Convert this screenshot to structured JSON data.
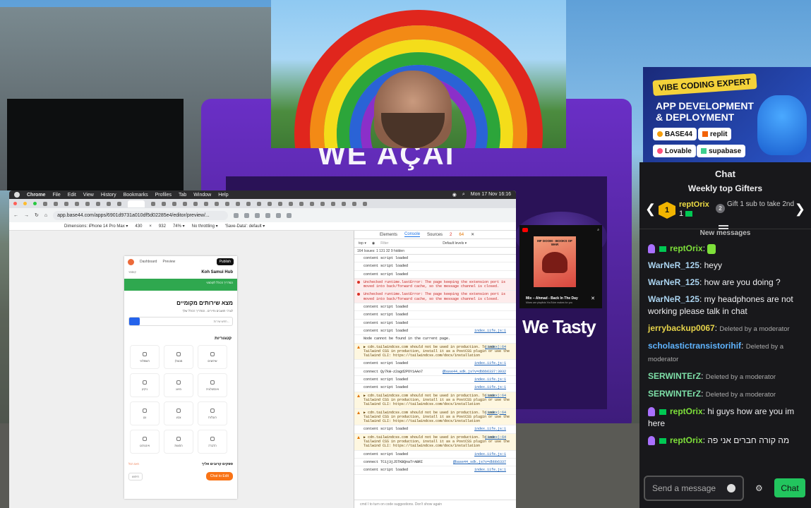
{
  "background": {
    "kiosk_sign": "WE AÇAÍ",
    "kiosk_side_text": "We Tasty"
  },
  "promo": {
    "badge": "VIBE CODING EXPERT",
    "line1": "APP DEVELOPMENT",
    "line2": "& DEPLOYMENT",
    "tools": [
      "BASE44",
      "replit",
      "Lovable",
      "supabase"
    ]
  },
  "chat": {
    "title": "Chat",
    "weekly_title": "Weekly top Gifters",
    "top_gifter": {
      "rank": "1",
      "name": "reptOrix",
      "count": "1"
    },
    "second": {
      "rank": "2",
      "text": "Gift 1 sub to take 2nd"
    },
    "new_messages": "New messages",
    "messages": [
      {
        "user": "reptOrix",
        "text": "",
        "color": "#7ee03a",
        "badge": true
      },
      {
        "user": "WarNeR_125",
        "text": "heyy",
        "color": "#aad3ef"
      },
      {
        "user": "WarNeR_125",
        "text": "how are you doing ?",
        "color": "#aad3ef"
      },
      {
        "user": "WarNeR_125",
        "text": "my headphones are not working please talk in chat",
        "color": "#aad3ef"
      },
      {
        "user": "jerrybackup0067",
        "text": "Deleted by a moderator",
        "color": "#e6d34a",
        "deleted": true
      },
      {
        "user": "scholastictransistorihif",
        "text": "Deleted by a moderator",
        "color": "#5fb4ff",
        "deleted": true
      },
      {
        "user": "SERWINTErZ",
        "text": "Deleted by a moderator",
        "color": "#7ee0a8",
        "deleted": true
      },
      {
        "user": "SERWINTErZ",
        "text": "Deleted by a moderator",
        "color": "#7ee0a8",
        "deleted": true
      },
      {
        "user": "reptOrix",
        "text": "hi guys how are you im here",
        "color": "#7ee03a",
        "badge": true
      },
      {
        "user": "reptOrix",
        "text": "מה קורה חברים אני פה",
        "color": "#7ee03a",
        "badge": true
      }
    ],
    "input_placeholder": "Send a message",
    "send_label": "Chat"
  },
  "mac": {
    "menu": [
      "Chrome",
      "File",
      "Edit",
      "View",
      "History",
      "Bookmarks",
      "Profiles",
      "Tab",
      "Window",
      "Help"
    ],
    "clock": "Mon 17 Nov 16:16",
    "url": "app.base44.com/apps/6901d9731a010df5d02285e4/editor/preview/...",
    "dimensions": "Dimensions: iPhone 14 Pro Max ▾",
    "width": "430",
    "height": "932",
    "zoom": "74% ▾",
    "throttle": "No throttling ▾",
    "save_data": "'Save-Data': default ▾"
  },
  "phone": {
    "nav_dashboard": "Dashboard",
    "nav_preview": "Preview",
    "publish": "Publish",
    "title": "Koh Samui Hub",
    "title_left": "קוסמוי",
    "banner": "המדריך הכולל לקוסמוי",
    "h1": "מצא שירותים מקומיים",
    "sub": "לצרכי תושבים ותיירים - המדריך הכולל שלך",
    "search_placeholder": "חפש שירות...",
    "categories_title": "קטגוריות",
    "categories": [
      "חשמלאי",
      "מנעולן",
      "שיפוצים",
      "ניקיון",
      "מיזוג",
      "אינסטלציה",
      "גנן",
      "צבע",
      "הובלות",
      "אינטרנט",
      "הסעות",
      "הדברה"
    ],
    "providers_title": "ספקים קרובים אליך",
    "see_all": "ראה הכל",
    "chip": "חיפוש",
    "cta": "Chat to Edit"
  },
  "console": {
    "tabs": [
      "Elements",
      "Console",
      "Sources"
    ],
    "issues": "2",
    "warns": "64",
    "filter_label": "Filter",
    "levels": "Default levels ▾",
    "top": "top ▾",
    "issues_line": "164 Issues: 1  131  32   9 hidden",
    "lines": [
      {
        "t": "content script loaded",
        "k": "log",
        "src": ""
      },
      {
        "t": "content script loaded",
        "k": "log",
        "src": ""
      },
      {
        "t": "content script loaded",
        "k": "log",
        "src": ""
      },
      {
        "t": "Unchecked runtime.lastError: The page keeping the extension port is moved into back/forward cache, so the message channel is closed.",
        "k": "err",
        "src": ""
      },
      {
        "t": "Unchecked runtime.lastError: The page keeping the extension port is moved into back/forward cache, so the message channel is closed.",
        "k": "err",
        "src": ""
      },
      {
        "t": "content script loaded",
        "k": "log",
        "src": ""
      },
      {
        "t": "content script loaded",
        "k": "log",
        "src": ""
      },
      {
        "t": "content script loaded",
        "k": "log",
        "src": ""
      },
      {
        "t": "content script loaded",
        "k": "log",
        "src": "index.iife.js:1"
      },
      {
        "t": "Node cannot be found in the current page.",
        "k": "log",
        "src": ""
      },
      {
        "t": "▶ cdn.tailwindcss.com should not be used in production. To use Tailwind CSS in production, install it as a PostCSS plugin or use the Tailwind CLI: https://tailwindcss.com/docs/installation",
        "k": "warn",
        "src": "(index):64"
      },
      {
        "t": "content script loaded",
        "k": "log",
        "src": "index.iife.js:1"
      },
      {
        "t": "connect Qy7kW-z2agd2POY1AAo7",
        "k": "log",
        "src": "@base44_sdk.js?v=dbbb6337:3932"
      },
      {
        "t": "content script loaded",
        "k": "log",
        "src": "index.iife.js:1"
      },
      {
        "t": "content script loaded",
        "k": "log",
        "src": "index.iife.js:1"
      },
      {
        "t": "▶ cdn.tailwindcss.com should not be used in production. To use Tailwind CSS in production, install it as a PostCSS plugin or use the Tailwind CLI: https://tailwindcss.com/docs/installation",
        "k": "warn",
        "src": "(index):64"
      },
      {
        "t": "▶ cdn.tailwindcss.com should not be used in production. To use Tailwind CSS in production, install it as a PostCSS plugin or use the Tailwind CLI: https://tailwindcss.com/docs/installation",
        "k": "warn",
        "src": "(index):64"
      },
      {
        "t": "content script loaded",
        "k": "log",
        "src": "index.iife.js:1"
      },
      {
        "t": "▶ cdn.tailwindcss.com should not be used in production. To use Tailwind CSS in production, install it as a PostCSS plugin or use the Tailwind CLI: https://tailwindcss.com/docs/installation",
        "k": "warn",
        "src": "(index):64"
      },
      {
        "t": "content script loaded",
        "k": "log",
        "src": "index.iife.js:1"
      },
      {
        "t": "connect TC1j3jJ5TKBQnaTrABRI",
        "k": "log",
        "src": "@base44_sdk.js?v=dbbb6337"
      },
      {
        "t": "content script loaded",
        "k": "log",
        "src": "index.iife.js:1"
      }
    ],
    "prompt": "cmd I to turn on code suggestions. Don't show again"
  },
  "youtube": {
    "album_title": "MF DOOM - BOOKS OF WAR",
    "track": "Mix – Ahmad - Back In The Day",
    "sub": "Mixes are playlists YouTube makes for you"
  }
}
